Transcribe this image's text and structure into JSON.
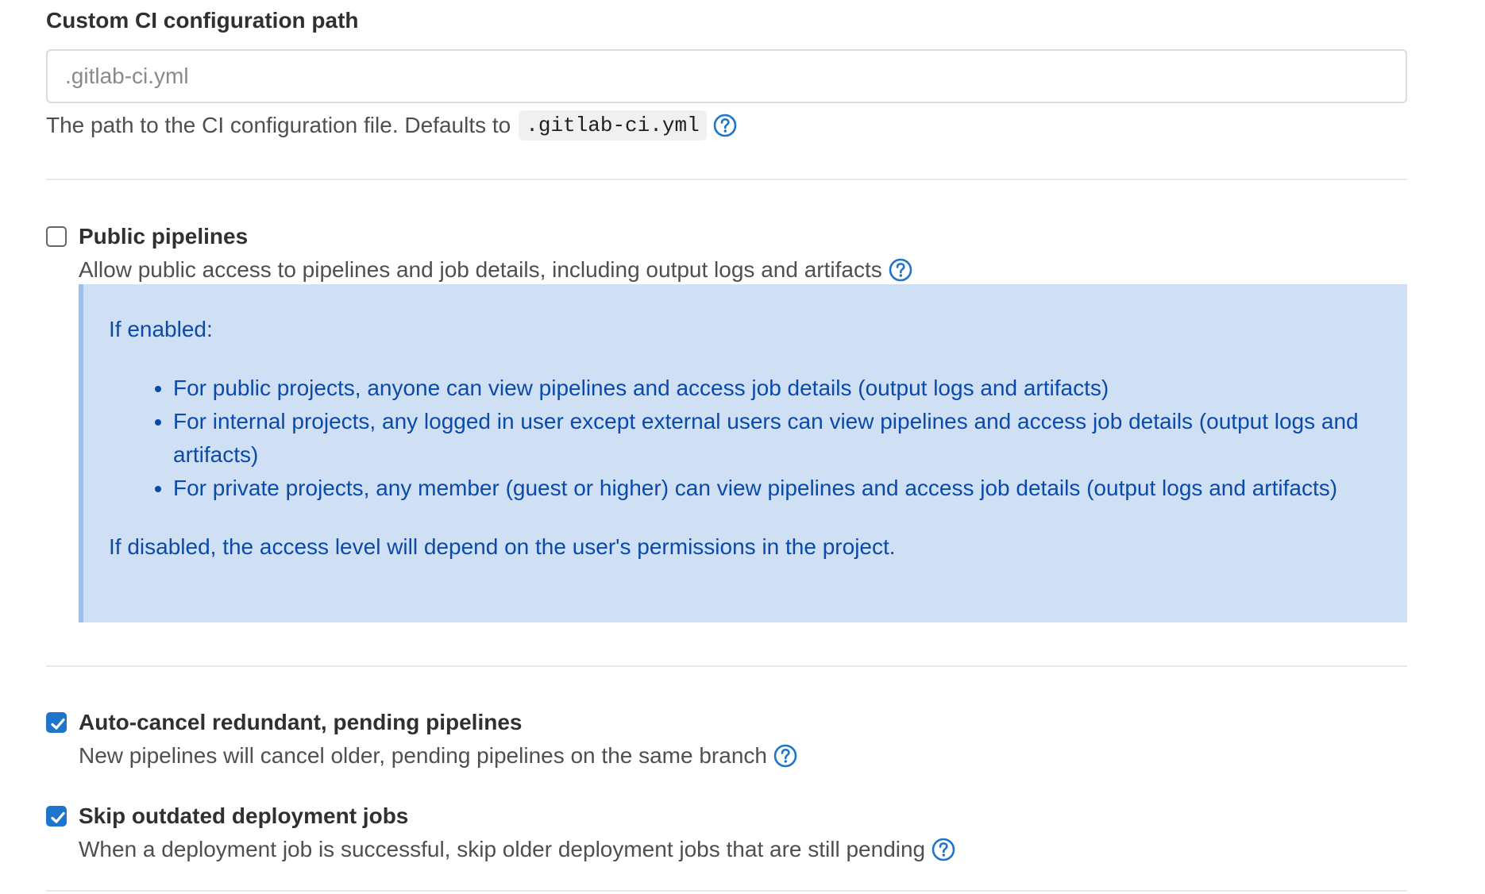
{
  "ci_config": {
    "label": "Custom CI configuration path",
    "placeholder": ".gitlab-ci.yml",
    "value": "",
    "help_text": "The path to the CI configuration file. Defaults to",
    "help_code": ".gitlab-ci.yml"
  },
  "public_pipelines": {
    "checked": false,
    "title": "Public pipelines",
    "help_text": "Allow public access to pipelines and job details, including output logs and artifacts",
    "info": {
      "intro": "If enabled:",
      "items": [
        "For public projects, anyone can view pipelines and access job details (output logs and artifacts)",
        "For internal projects, any logged in user except external users can view pipelines and access job details (output logs and artifacts)",
        "For private projects, any member (guest or higher) can view pipelines and access job details (output logs and artifacts)"
      ],
      "outro": "If disabled, the access level will depend on the user's permissions in the project."
    }
  },
  "auto_cancel": {
    "checked": true,
    "title": "Auto-cancel redundant, pending pipelines",
    "help_text": "New pipelines will cancel older, pending pipelines on the same branch"
  },
  "skip_outdated": {
    "checked": true,
    "title": "Skip outdated deployment jobs",
    "help_text": "When a deployment job is successful, skip older deployment jobs that are still pending"
  },
  "icons": {
    "help": "question-circle-icon",
    "check": "checkmark-icon"
  },
  "colors": {
    "accent": "#1f75cb",
    "info_bg": "#cfe0f5",
    "info_text": "#0b4aa8",
    "info_border": "#9fc0ec"
  }
}
